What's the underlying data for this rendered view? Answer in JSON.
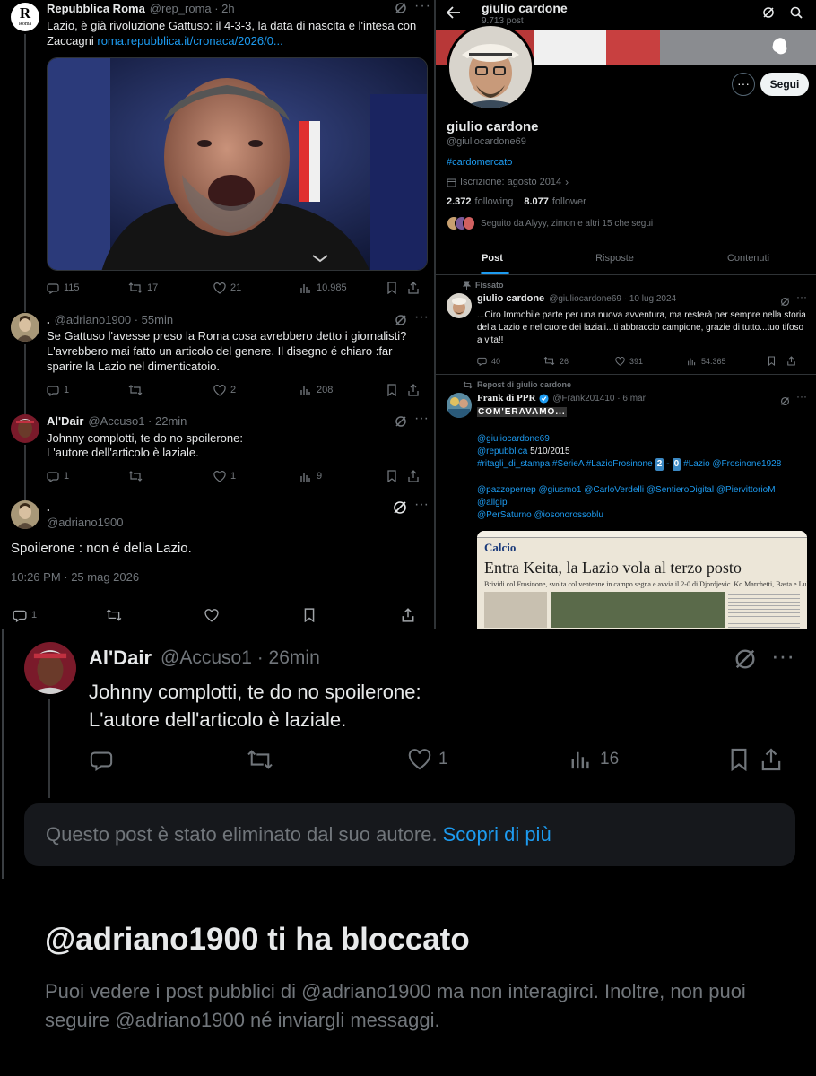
{
  "tweet1": {
    "name": "Repubblica Roma",
    "handle": "@rep_roma · 2h",
    "logo_letter": "R",
    "logo_sub": "Roma",
    "text": "Lazio, è già rivoluzione Gattuso: il 4-3-3, la data di nascita e l'intesa con Zaccagni",
    "link": "roma.repubblica.it/cronaca/2026/0...",
    "replies": "115",
    "retweets": "17",
    "likes": "21",
    "views": "10.985"
  },
  "tweet2": {
    "name": ".",
    "handle": "@adriano1900 · 55min",
    "text": "Se Gattuso l'avesse preso la Roma cosa avrebbero detto i giornalisti? L'avrebbero mai fatto un articolo del genere. Il disegno é chiaro :far sparire la Lazio nel dimenticatoio.",
    "replies": "1",
    "retweets": "",
    "likes": "2",
    "views": "208"
  },
  "tweet3": {
    "name": "Al'Dair",
    "handle": "@Accuso1 · 22min",
    "text_line1": "Johnny complotti, te do no spoilerone:",
    "text_line2": "L'autore dell'articolo è laziale.",
    "replies": "1",
    "likes": "1",
    "views": "9"
  },
  "tweet4": {
    "name": ".",
    "handle": "@adriano1900",
    "text": "Spoilerone : non é della Lazio.",
    "timestamp": "10:26 PM · 25 mag 2026",
    "replies": "1"
  },
  "profile": {
    "header_name": "giulio cardone",
    "header_posts": "9.713 post",
    "name": "giulio cardone",
    "handle": "@giuliocardone69",
    "hashtag": "#cardomercato",
    "joined": "Iscrizione: agosto 2014",
    "following_count": "2.372",
    "following_label": "following",
    "followers_count": "8.077",
    "followers_label": "follower",
    "followed_by": "Seguito da Alyyy, zimon e altri 15 che segui",
    "follow_button": "Segui",
    "tabs": [
      "Post",
      "Risposte",
      "Contenuti"
    ]
  },
  "pinned": {
    "label": "Fissato",
    "name": "giulio cardone",
    "handle": "@giuliocardone69 · 10 lug 2024",
    "text": "...Ciro Immobile parte per una nuova avventura, ma resterà per sempre nella storia della Lazio e nel cuore dei laziali...ti abbraccio campione, grazie di tutto...tuo tifoso a vita!!",
    "replies": "40",
    "retweets": "26",
    "likes": "391",
    "views": "54.365"
  },
  "repost": {
    "label": "Repost di giulio cardone",
    "name": "Frank di PPR",
    "handle": "@Frank201410 · 6 mar",
    "title_text": "COM'ERAVAMO...",
    "mention1": "@giuliocardone69",
    "mention2_prefix": "@repubblica",
    "mention2_date": "5/10/2015",
    "hashtags_a": "#ritagli_di_stampa #SerieA #LazioFrosinone",
    "score_a": "2",
    "score_sep": "-",
    "score_b": "0",
    "hashtags_b": "#Lazio @Frosinone1928",
    "mentions_line": "@pazzoperrep @giusmo1 @CarloVerdelli @SentieroDigital @PiervittorioM",
    "mentions_line2": "@allgip",
    "mentions_line3": "@PerSaturno @iosonorossoblu",
    "clip_section": "Calcio",
    "clip_title": "Entra Keita, la Lazio vola al terzo posto",
    "clip_sub": "Brividi col Frosinone, svolta col ventenne in campo segna e avvia il 2-0 di Djordjevic. Ko Marchetti, Basta e Lulic"
  },
  "big_tweet": {
    "name": "Al'Dair",
    "handle": "@Accuso1 · 26min",
    "text_line1": "Johnny complotti, te do no spoilerone:",
    "text_line2": "L'autore dell'articolo è laziale.",
    "replies": "",
    "retweets": "",
    "likes": "1",
    "views": "16"
  },
  "deleted_notice": {
    "text": "Questo post è stato eliminato dal suo autore.",
    "link": "Scopri di più"
  },
  "blocked": {
    "title": "@adriano1900 ti ha bloccato",
    "desc": "Puoi vedere i post pubblici di @adriano1900 ma non interagirci. Inoltre, non puoi seguire @adriano1900 né inviargli messaggi."
  },
  "colors": {
    "accent": "#1d9bf0",
    "muted": "#71767b",
    "background": "#000000"
  }
}
